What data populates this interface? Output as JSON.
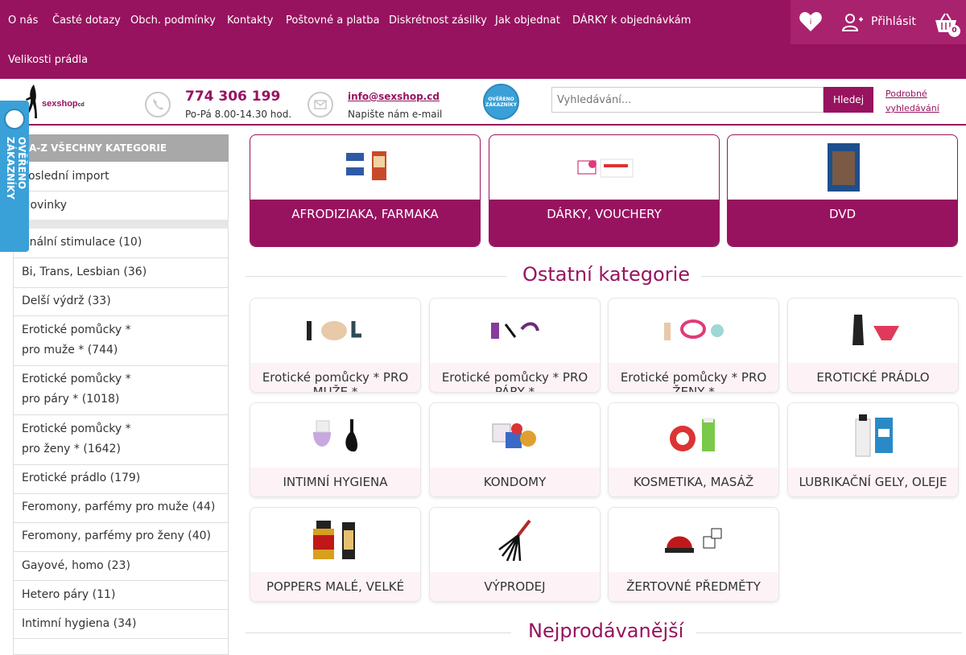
{
  "topnav": {
    "links": [
      "O nás",
      "Časté dotazy",
      "Obch. podmínky",
      "Kontakty",
      "Poštovné a platba",
      "Diskrétnost zásilky",
      "Jak objednat",
      "DÁRKY k objednávkám",
      "Velikosti prádla"
    ],
    "login_label": "Přihlásit",
    "cart_count": "0"
  },
  "header": {
    "logo_text": "sexshop",
    "logo_suffix": "cd",
    "phone": "774 306 199",
    "phone_hours": "Po-Pá 8.00-14.30 hod.",
    "email": "info@sexshop.cd",
    "email_sub": "Napište nám e-mail",
    "badge_text": "OVĚŘENO ZÁKAZNÍKY",
    "search_placeholder": "Vyhledávání...",
    "search_button": "Hledej",
    "advanced_search": "Podrobné vyhledávání"
  },
  "side_badge": "OVĚŘENO ZÁKAZNÍKY",
  "sidebar": {
    "header": "A-Z VŠECHNY KATEGORIE",
    "top_items": [
      "Poslední import",
      "Novinky"
    ],
    "items": [
      "Anální stimulace (10)",
      "Bi, Trans, Lesbian (36)",
      "Delší výdrž (33)",
      "Erotické pomůcky * pro muže * (744)",
      "Erotické pomůcky * pro páry * (1018)",
      "Erotické pomůcky * pro ženy * (1642)",
      "Erotické prádlo (179)",
      "Feromony, parfémy pro muže (44)",
      "Feromony, parfémy pro ženy (40)",
      "Gayové, homo (23)",
      "Hetero páry (11)",
      "Intimní hygiena (34)"
    ]
  },
  "top_categories": [
    "AFRODIZIAKA, FARMAKA",
    "DÁRKY, VOUCHERY",
    "DVD"
  ],
  "other_title": "Ostatní kategorie",
  "other_categories": [
    "Erotické pomůcky * PRO MUŽE *",
    "Erotické pomůcky * PRO PÁRY *",
    "Erotické pomůcky * PRO ŽENY *",
    "EROTICKÉ PRÁDLO",
    "INTIMNÍ HYGIENA",
    "KONDOMY",
    "KOSMETIKA, MASÁŽ",
    "LUBRIKAČNÍ GELY, OLEJE",
    "POPPERS MALÉ, VELKÉ",
    "VÝPRODEJ",
    "ŽERTOVNÉ PŘEDMĚTY"
  ],
  "bestsellers_title": "Nejprodávanější",
  "colors": {
    "brand": "#97135f",
    "badge_blue": "#3aa0d8",
    "card_bottom": "#fdf3f6"
  }
}
